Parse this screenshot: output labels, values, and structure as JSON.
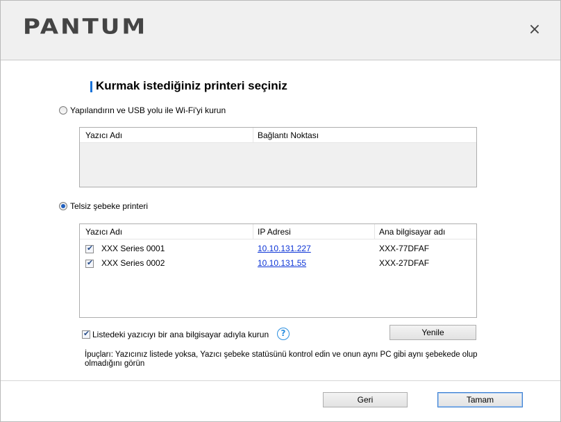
{
  "header": {
    "logo_text": "PANTUM",
    "close_glyph": "×"
  },
  "page_title": "Kurmak istediğiniz printeri seçiniz",
  "option_usb": {
    "label": "Yapılandırın ve USB yolu ile Wi-Fi'yi kurun",
    "checked": false
  },
  "usb_table": {
    "columns": [
      "Yazıcı Adı",
      "Bağlantı Noktası"
    ],
    "rows": []
  },
  "option_wireless": {
    "label": "Telsiz şebeke printeri",
    "checked": true
  },
  "wireless_table": {
    "columns": [
      "Yazıcı Adı",
      "IP Adresi",
      "Ana bilgisayar adı"
    ],
    "rows": [
      {
        "checked": true,
        "name": "XXX Series 0001",
        "ip": "10.10.131.227",
        "host": "XXX-77DFAF"
      },
      {
        "checked": true,
        "name": "XXX Series 0002",
        "ip": "10.10.131.55",
        "host": "XXX-27DFAF"
      }
    ]
  },
  "hostname_option": {
    "label": "Listedeki yazıcıyı bir ana bilgisayar adıyla kurun",
    "checked": true,
    "help_glyph": "?"
  },
  "refresh_label": "Yenile",
  "hint_text": "İpuçları: Yazıcınız listede yoksa, Yazıcı şebeke statüsünü kontrol edin ve onun aynı PC gibi aynı şebekede olup olmadığını görün",
  "footer": {
    "back_label": "Geri",
    "ok_label": "Tamam"
  },
  "colors": {
    "accent": "#1a73d9",
    "link": "#0b33d6",
    "header_bg": "#f0f0f0"
  }
}
